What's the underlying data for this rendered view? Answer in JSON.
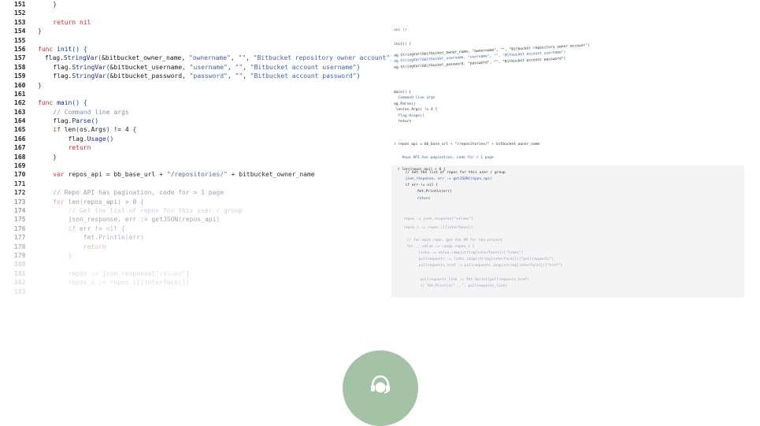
{
  "code": {
    "lines": [
      {
        "n": "151",
        "text": "    }"
      },
      {
        "n": "152",
        "text": ""
      },
      {
        "n": "153",
        "text": "    return nil"
      },
      {
        "n": "154",
        "text": "}"
      },
      {
        "n": "155",
        "text": ""
      },
      {
        "n": "156",
        "text": "func init() {"
      },
      {
        "n": "157",
        "text": "    flag.StringVar(&bitbucket_owner_name, \"ownername\", \"\", \"Bitbucket repository owner account\")"
      },
      {
        "n": "158",
        "text": "    flag.StringVar(&bitbucket_username, \"username\", \"\", \"Bitbucket account username\")"
      },
      {
        "n": "159",
        "text": "    flag.StringVar(&bitbucket_password, \"password\", \"\", \"Bitbucket account password\")"
      },
      {
        "n": "160",
        "text": "}"
      },
      {
        "n": "161",
        "text": ""
      },
      {
        "n": "162",
        "text": "func main() {"
      },
      {
        "n": "163",
        "text": "    // Command line args"
      },
      {
        "n": "164",
        "text": "    flag.Parse()"
      },
      {
        "n": "165",
        "text": "    if len(os.Args) != 4 {"
      },
      {
        "n": "166",
        "text": "        flag.Usage()"
      },
      {
        "n": "167",
        "text": "        return"
      },
      {
        "n": "168",
        "text": "    }"
      },
      {
        "n": "169",
        "text": ""
      },
      {
        "n": "170",
        "text": "    var repos_api = bb_base_url + \"/repositories/\" + bitbucket_owner_name"
      },
      {
        "n": "171",
        "text": ""
      },
      {
        "n": "172",
        "text": "    // Repo API has pagination, code for > 1 page"
      },
      {
        "n": "173",
        "text": "    for len(repos_api) > 0 {"
      },
      {
        "n": "174",
        "text": "        // Get the list of repos for this user / group"
      },
      {
        "n": "175",
        "text": "        json_response, err := getJSON(repos_api)"
      },
      {
        "n": "176",
        "text": "        if err != nil {"
      },
      {
        "n": "177",
        "text": "            fmt.Println(err)"
      },
      {
        "n": "178",
        "text": "            return"
      },
      {
        "n": "179",
        "text": "        }"
      },
      {
        "n": "180",
        "text": ""
      },
      {
        "n": "181",
        "text": "        repos := json_response[\"values\"]"
      },
      {
        "n": "182",
        "text": "        repos_i := repos.([]interface{})"
      },
      {
        "n": "183",
        "text": ""
      }
    ]
  },
  "minimap": {
    "lines": [
      {
        "t": "unc ()"
      },
      {
        "t": "init() {"
      },
      {
        "t": "ag.StringVar(&bitbucket_owner_name, \"ownername\", \"\", \"Bitbucket repository owner account\")"
      },
      {
        "t": "ag.StringVar(&bitbucket_username, \"username\", \"\", \"Bitbucket account username\")"
      },
      {
        "t": "ag.StringVar(&bitbucket_password, \"password\", \"\", \"Bitbucket account password\")"
      },
      {
        "t": "main() {"
      },
      {
        "t": "  Command line args"
      },
      {
        "t": "ag.Parse()"
      },
      {
        "t": " len(os.Args) != 4 {"
      },
      {
        "t": "  flag.Usage()"
      },
      {
        "t": "  return"
      },
      {
        "t": "r repos_api = bb_base_url + \"/repositories/\" + bitbucket_owner_name"
      },
      {
        "t": "  Repo API has pagination, code for > 1 page"
      },
      {
        "t": "r len(repos_api) > 0 {"
      },
      {
        "t": "  // Get the list of repos for this user / group"
      },
      {
        "t": "  json_response, err := getJSON(repos_api)"
      },
      {
        "t": "  if err != nil {"
      },
      {
        "t": "      fmt.Println(err)"
      },
      {
        "t": "      return"
      },
      {
        "t": "  repos := json_response[\"values\"]"
      },
      {
        "t": "  repos_i := repos.([]interface{})"
      },
      {
        "t": "  // for each repo, get the PR for the project"
      },
      {
        "t": "  for _, value := range repos_i {"
      },
      {
        "t": "      links := value.(map[string]interface{})[\"links\"]"
      },
      {
        "t": "      pullrequests := links.(map[string]interface{})[\"pullrequests\"]"
      },
      {
        "t": "      pullrequests_href := pullrequests.(map[string]interface{})[\"href\"]"
      },
      {
        "t": "      pullrequests_link := fmt.Sprint(pullrequests_href)"
      },
      {
        "t": "      // fmt.Println(\"...\", pullrequests_link)"
      }
    ]
  },
  "support": {
    "icon": "headset-icon",
    "color": "#a4c2a6"
  }
}
